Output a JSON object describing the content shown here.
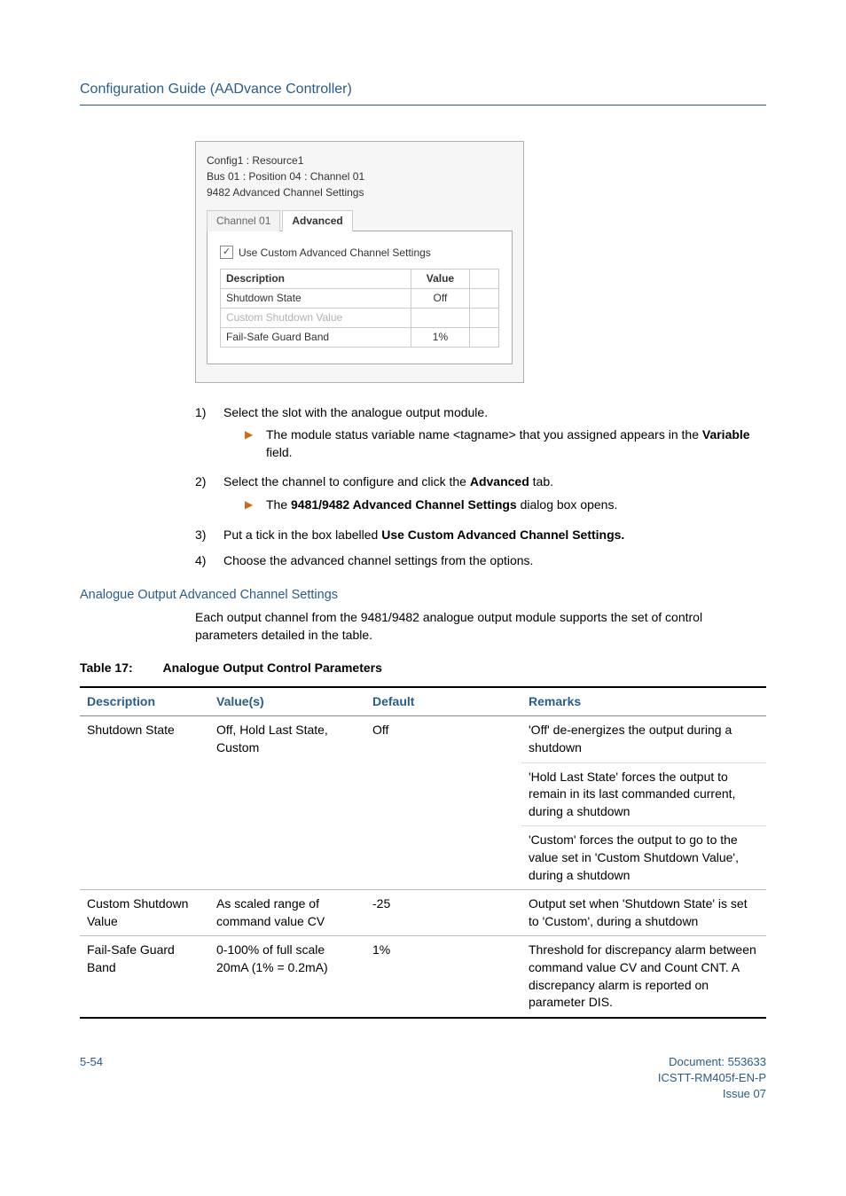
{
  "header": {
    "title": "Configuration Guide (AADvance Controller)"
  },
  "dialog": {
    "line1": "Config1 : Resource1",
    "line2": "Bus 01 : Position 04 : Channel 01",
    "line3": "9482 Advanced Channel Settings",
    "tabs": {
      "channel": "Channel 01",
      "advanced": "Advanced"
    },
    "checkbox_label": "Use Custom Advanced Channel Settings",
    "checkbox_checked_glyph": "✓",
    "table": {
      "headers": {
        "desc": "Description",
        "value": "Value"
      },
      "rows": [
        {
          "desc": "Shutdown State",
          "value": "Off",
          "disabled": false
        },
        {
          "desc": "Custom Shutdown Value",
          "value": "",
          "disabled": true
        },
        {
          "desc": "Fail-Safe Guard Band",
          "value": "1%",
          "disabled": false
        }
      ]
    }
  },
  "steps": [
    {
      "num": "1)",
      "text": "Select the slot with the analogue output module.",
      "sub": [
        {
          "pre": "The module status variable name <tagname> that you assigned appears in the ",
          "bold": "Variable",
          "post": " field."
        }
      ]
    },
    {
      "num": "2)",
      "text_pre": "Select the channel to configure and click the ",
      "text_bold": "Advanced",
      "text_post": " tab.",
      "sub": [
        {
          "pre": "The ",
          "bold": "9481/9482 Advanced Channel Settings",
          "post": " dialog box opens."
        }
      ]
    },
    {
      "num": "3)",
      "text_pre": "Put a tick in the box labelled ",
      "text_bold": "Use Custom Advanced Channel Settings.",
      "text_post": ""
    },
    {
      "num": "4)",
      "text": "Choose the advanced channel settings from the options."
    }
  ],
  "section": {
    "heading": "Analogue Output Advanced Channel Settings",
    "body": "Each output channel from the 9481/9482 analogue output module supports the set of control parameters detailed in the table."
  },
  "table_caption": {
    "num": "Table 17:",
    "title": "Analogue Output Control Parameters"
  },
  "params_table": {
    "headers": {
      "desc": "Description",
      "values": "Value(s)",
      "default": "Default",
      "remarks": "Remarks"
    },
    "rows": [
      {
        "desc": "Shutdown State",
        "values": "Off, Hold Last State, Custom",
        "default": "Off",
        "remarks": [
          "'Off' de-energizes the output during a shutdown",
          "'Hold Last State' forces the output to remain in its last commanded current, during a shutdown",
          "'Custom' forces the output to go to the value set in 'Custom Shutdown Value', during a shutdown"
        ]
      },
      {
        "desc": "Custom Shutdown Value",
        "values": "As scaled range of command value CV",
        "default": "-25",
        "remarks": [
          "Output set when 'Shutdown State' is set to 'Custom', during a shutdown"
        ]
      },
      {
        "desc": "Fail-Safe Guard Band",
        "values": "0-100% of full scale 20mA (1% = 0.2mA)",
        "default": "1%",
        "remarks": [
          "Threshold for discrepancy alarm between command value CV and Count CNT. A discrepancy alarm is reported on parameter DIS."
        ]
      }
    ]
  },
  "footer": {
    "left": "5-54",
    "right1": "Document: 553633",
    "right2": "ICSTT-RM405f-EN-P",
    "right3": "Issue 07"
  }
}
